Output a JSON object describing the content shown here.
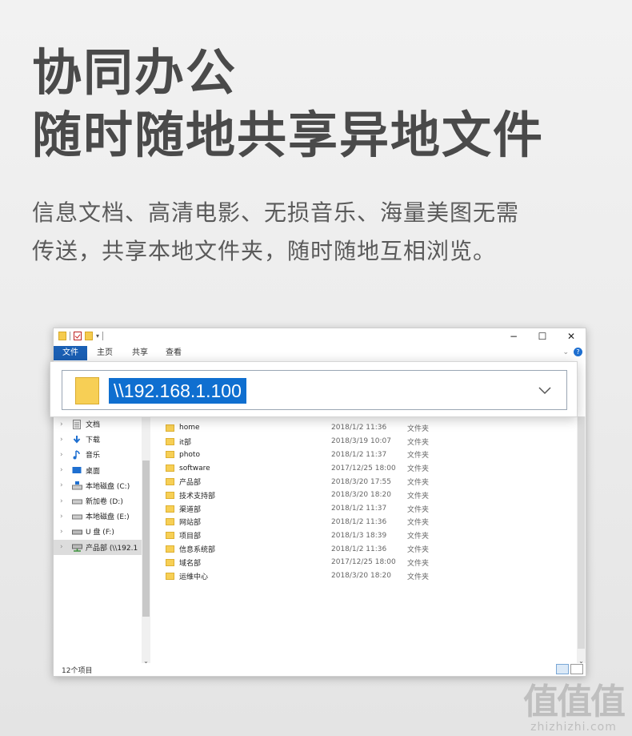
{
  "headline": {
    "line1": "协同办公",
    "line2": "随时随地共享异地文件"
  },
  "description": {
    "line1": "信息文档、高清电影、无损音乐、海量美图无需",
    "line2": "传送，共享本地文件夹，随时随地互相浏览。"
  },
  "window": {
    "controls": {
      "minimize": "−",
      "maximize": "☐",
      "close": "✕"
    },
    "ribbon": {
      "tabs": [
        "文件",
        "主页",
        "共享",
        "查看"
      ],
      "expand": "⌄",
      "help": "?"
    },
    "address": {
      "value": "\\\\192.168.1.100"
    },
    "nav": {
      "items": [
        {
          "label": "文档",
          "icon": "document-icon"
        },
        {
          "label": "下载",
          "icon": "download-icon"
        },
        {
          "label": "音乐",
          "icon": "music-icon"
        },
        {
          "label": "桌面",
          "icon": "desktop-icon"
        },
        {
          "label": "本地磁盘 (C:)",
          "icon": "drive-c-icon"
        },
        {
          "label": "新加卷 (D:)",
          "icon": "drive-icon"
        },
        {
          "label": "本地磁盘 (E:)",
          "icon": "drive-icon"
        },
        {
          "label": "U 盘 (F:)",
          "icon": "usb-drive-icon"
        },
        {
          "label": "产品部 (\\\\192.1",
          "icon": "network-drive-icon"
        }
      ]
    },
    "files": [
      {
        "name": "home",
        "date": "2018/1/2 11:36",
        "type": "文件夹"
      },
      {
        "name": "it部",
        "date": "2018/3/19 10:07",
        "type": "文件夹"
      },
      {
        "name": "photo",
        "date": "2018/1/2 11:37",
        "type": "文件夹"
      },
      {
        "name": "software",
        "date": "2017/12/25 18:00",
        "type": "文件夹"
      },
      {
        "name": "产品部",
        "date": "2018/3/20 17:55",
        "type": "文件夹"
      },
      {
        "name": "技术支持部",
        "date": "2018/3/20 18:20",
        "type": "文件夹"
      },
      {
        "name": "渠道部",
        "date": "2018/1/2 11:37",
        "type": "文件夹"
      },
      {
        "name": "网站部",
        "date": "2018/1/2 11:36",
        "type": "文件夹"
      },
      {
        "name": "项目部",
        "date": "2018/1/3 18:39",
        "type": "文件夹"
      },
      {
        "name": "信息系统部",
        "date": "2018/1/2 11:36",
        "type": "文件夹"
      },
      {
        "name": "域名部",
        "date": "2017/12/25 18:00",
        "type": "文件夹"
      },
      {
        "name": "运维中心",
        "date": "2018/3/20 18:20",
        "type": "文件夹"
      }
    ],
    "status": {
      "count": "12个项目"
    }
  },
  "watermark": {
    "line1": "值值值",
    "line2": "zhizhizhi.com"
  },
  "colors": {
    "accent": "#0f6fd0",
    "folder": "#f7cf55",
    "file_tab": "#1a5fb4"
  }
}
